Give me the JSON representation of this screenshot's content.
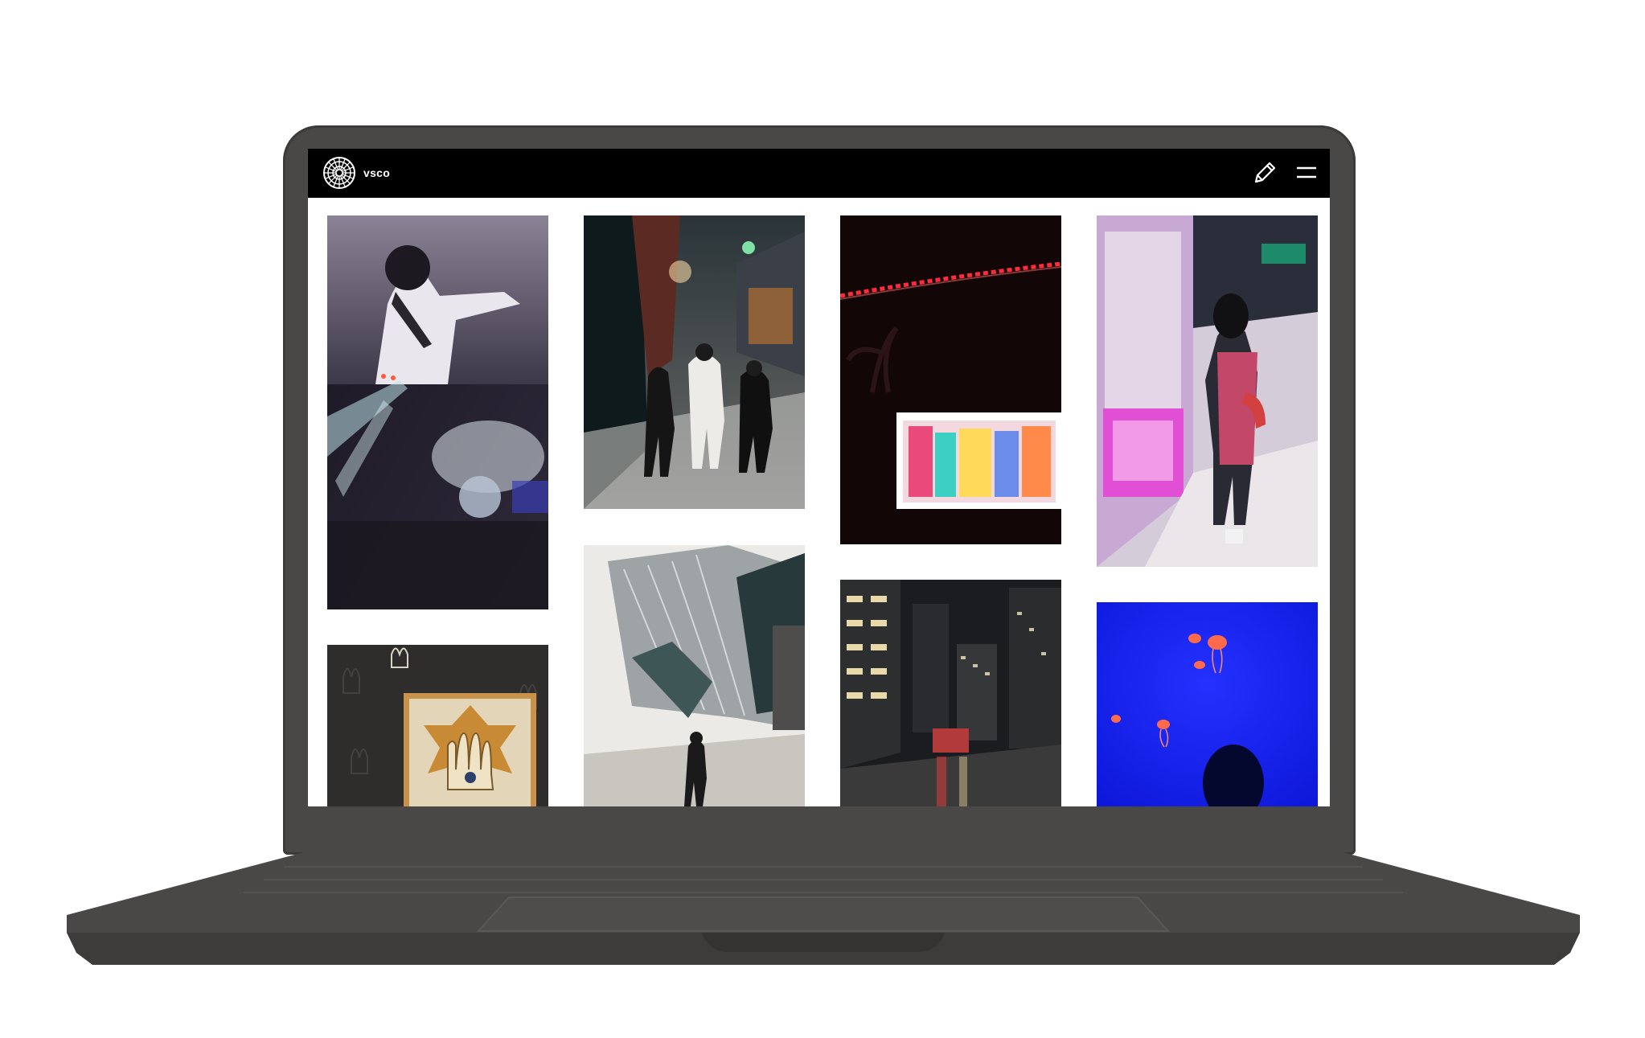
{
  "app": {
    "brand": "vsco"
  },
  "colors": {
    "navbar": "#000000",
    "laptop": "#4a4747",
    "content_bg": "#ffffff"
  },
  "navbar": {
    "logo_icon": "vsco-logo-icon",
    "edit_icon": "pencil-icon",
    "menu_icon": "hamburger-menu-icon"
  },
  "gallery": {
    "columns": 4,
    "items": [
      {
        "id": "concert-performer",
        "column": 1
      },
      {
        "id": "street-night-walk",
        "column": 2
      },
      {
        "id": "red-lights-screen",
        "column": 3
      },
      {
        "id": "arcade-claw-machines",
        "column": 4
      },
      {
        "id": "hamsa-artwork",
        "column": 1
      },
      {
        "id": "crystal-building",
        "column": 2
      },
      {
        "id": "city-night-street",
        "column": 3
      },
      {
        "id": "jellyfish-blue",
        "column": 4
      }
    ]
  }
}
